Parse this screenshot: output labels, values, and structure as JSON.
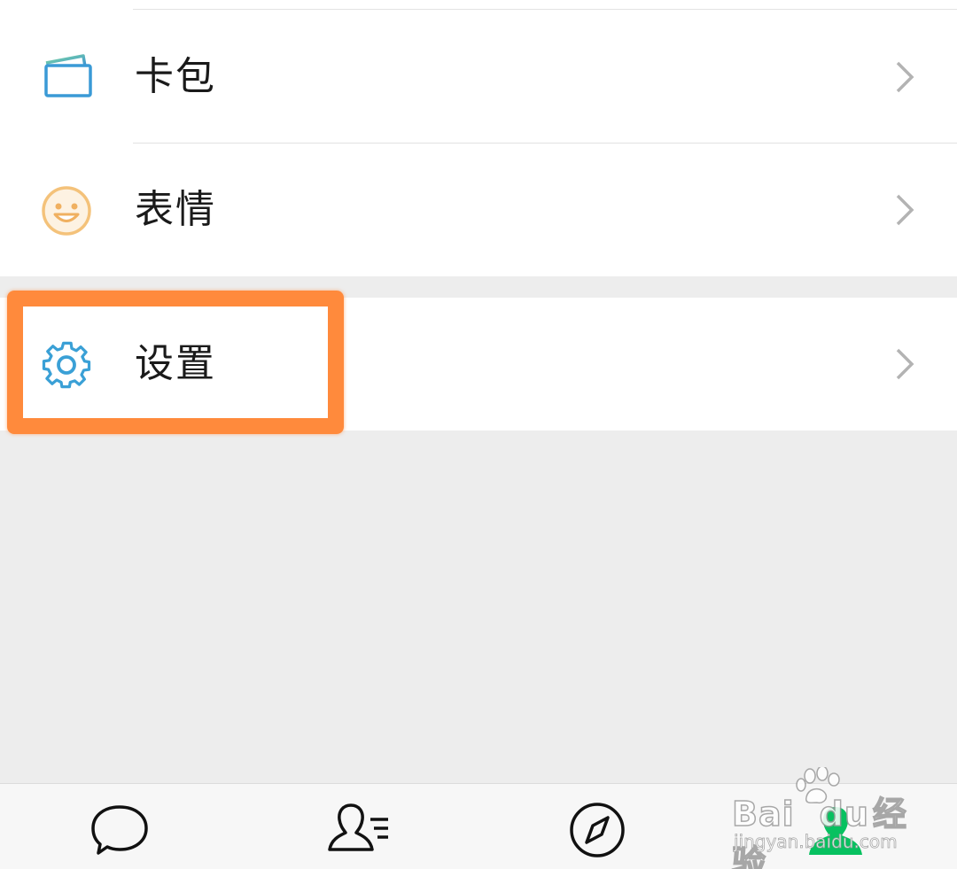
{
  "menu": {
    "items": [
      {
        "label": "卡包",
        "icon": "card-wallet-icon"
      },
      {
        "label": "表情",
        "icon": "smiley-icon"
      }
    ],
    "settings": {
      "label": "设置",
      "icon": "gear-icon"
    }
  },
  "tabbar": {
    "tabs": [
      {
        "name": "chats",
        "icon": "chat-bubble-icon"
      },
      {
        "name": "contacts",
        "icon": "contacts-icon"
      },
      {
        "name": "discover",
        "icon": "compass-icon"
      },
      {
        "name": "me",
        "icon": "person-icon",
        "active": true
      }
    ]
  },
  "watermark": {
    "brand": "Bai",
    "brand_cn": "经验",
    "url": "jingyan.baidu.com"
  },
  "colors": {
    "accent": "#07c160",
    "highlight": "#ff8a3c",
    "background": "#ededed"
  }
}
